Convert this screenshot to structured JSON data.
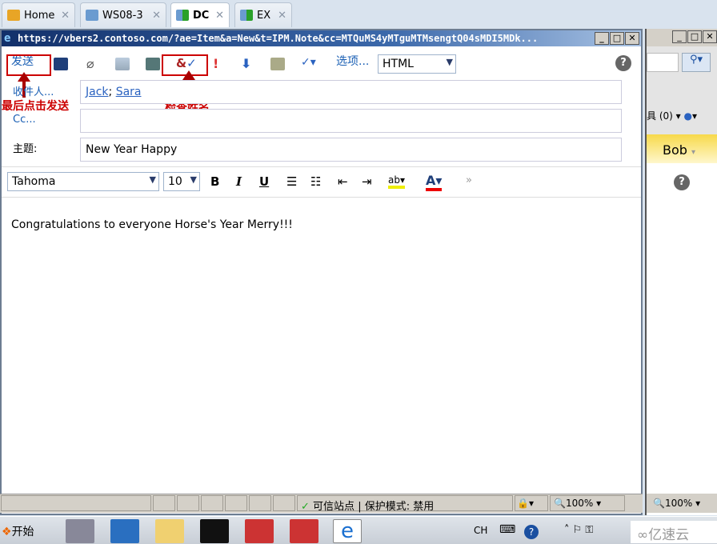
{
  "tabs": [
    {
      "label": "Home",
      "icon": "home-icon"
    },
    {
      "label": "WS08-3",
      "icon": "vm-icon"
    },
    {
      "label": "DC",
      "icon": "vm-running-icon",
      "active": true
    },
    {
      "label": "EX",
      "icon": "vm-running-icon"
    }
  ],
  "window": {
    "url": "https://vbers2.contoso.com/?ae=Item&a=New&t=IPM.Note&cc=MTQuMS4yMTguMTMsengtQ04sMDI5MDk...",
    "min": "_",
    "max": "□",
    "close": "✕"
  },
  "toolbar": {
    "send": "发送",
    "options": "选项...",
    "format": "HTML"
  },
  "annotations": {
    "send_hint": "最后点击发送",
    "check_names_hint": "检查姓名"
  },
  "form": {
    "to_label": "收件人...",
    "to_recipients": [
      "Jack",
      "Sara"
    ],
    "to_sep": ";",
    "cc_label": "Cc...",
    "cc_value": "",
    "subject_label": "主题:",
    "subject_value": "New Year Happy"
  },
  "format_bar": {
    "font": "Tahoma",
    "size": "10",
    "bold": "B",
    "italic": "I",
    "underline": "U"
  },
  "body": {
    "text": "Congratulations to everyone Horse's Year Merry!!!"
  },
  "status": {
    "zone": "可信站点",
    "protected_mode": "保护模式: 禁用",
    "zoom": "100%"
  },
  "background_window": {
    "tools": "具 (0)",
    "user": "Bob",
    "zoom": "100%"
  },
  "taskbar": {
    "start": "开始",
    "lang": "CH",
    "watermark": "亿速云"
  }
}
